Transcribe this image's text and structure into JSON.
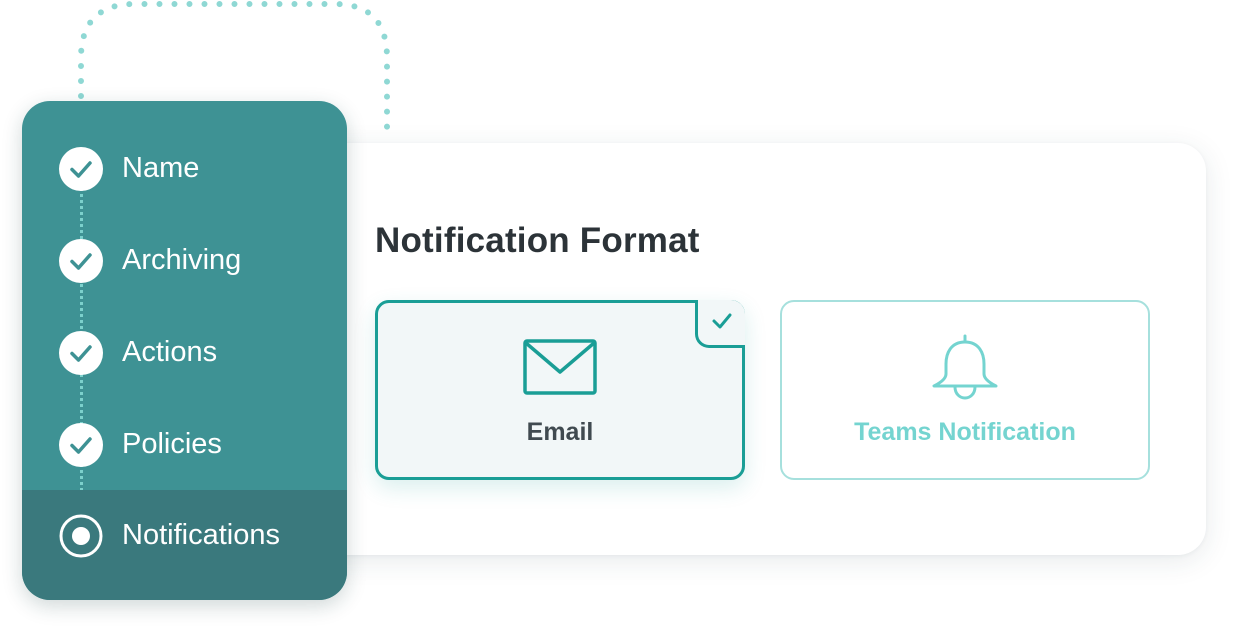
{
  "steps": [
    {
      "label": "Name",
      "state": "completed"
    },
    {
      "label": "Archiving",
      "state": "completed"
    },
    {
      "label": "Actions",
      "state": "completed"
    },
    {
      "label": "Policies",
      "state": "completed"
    },
    {
      "label": "Notifications",
      "state": "current"
    }
  ],
  "card": {
    "title": "Notification Format",
    "options": [
      {
        "label": "Email",
        "icon": "envelope-icon",
        "selected": true
      },
      {
        "label": "Teams Notification",
        "icon": "bell-icon",
        "selected": false
      }
    ]
  },
  "colors": {
    "panel": "#3e9294",
    "panel_active": "#3a797d",
    "accent": "#1a9e96",
    "accent_light": "#74d4d0",
    "title": "#2c3338"
  }
}
